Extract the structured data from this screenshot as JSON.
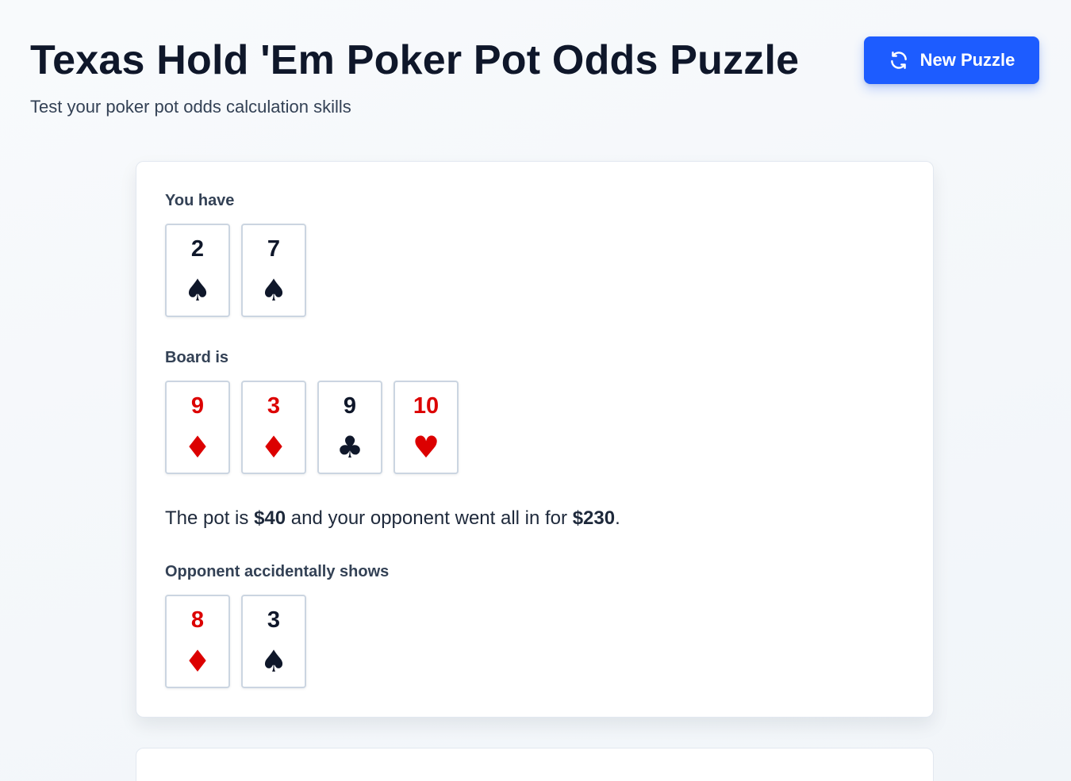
{
  "header": {
    "title": "Texas Hold 'Em Poker Pot Odds Puzzle",
    "subtitle": "Test your poker pot odds calculation skills",
    "new_puzzle_label": "New Puzzle"
  },
  "puzzle": {
    "hand_label": "You have",
    "hand": [
      {
        "rank": "2",
        "suit": "♠",
        "color": "black"
      },
      {
        "rank": "7",
        "suit": "♠",
        "color": "black"
      }
    ],
    "board_label": "Board is",
    "board": [
      {
        "rank": "9",
        "suit": "♦",
        "color": "red"
      },
      {
        "rank": "3",
        "suit": "♦",
        "color": "red"
      },
      {
        "rank": "9",
        "suit": "♣",
        "color": "black"
      },
      {
        "rank": "10",
        "suit": "♥",
        "color": "red"
      }
    ],
    "pot_prefix": "The pot is ",
    "pot_amount": "$40",
    "pot_middle": " and your opponent went all in for ",
    "allin_amount": "$230",
    "pot_suffix": ".",
    "opponent_label": "Opponent accidentally shows",
    "opponent": [
      {
        "rank": "8",
        "suit": "♦",
        "color": "red"
      },
      {
        "rank": "3",
        "suit": "♠",
        "color": "black"
      }
    ]
  },
  "colors": {
    "accent": "#1d5cff",
    "red_suit": "#dc0000",
    "black_suit": "#0f172a"
  },
  "icons": {
    "new_puzzle": "refresh-icon",
    "spade": "spade-icon",
    "diamond": "diamond-icon",
    "club": "club-icon",
    "heart": "heart-icon"
  }
}
